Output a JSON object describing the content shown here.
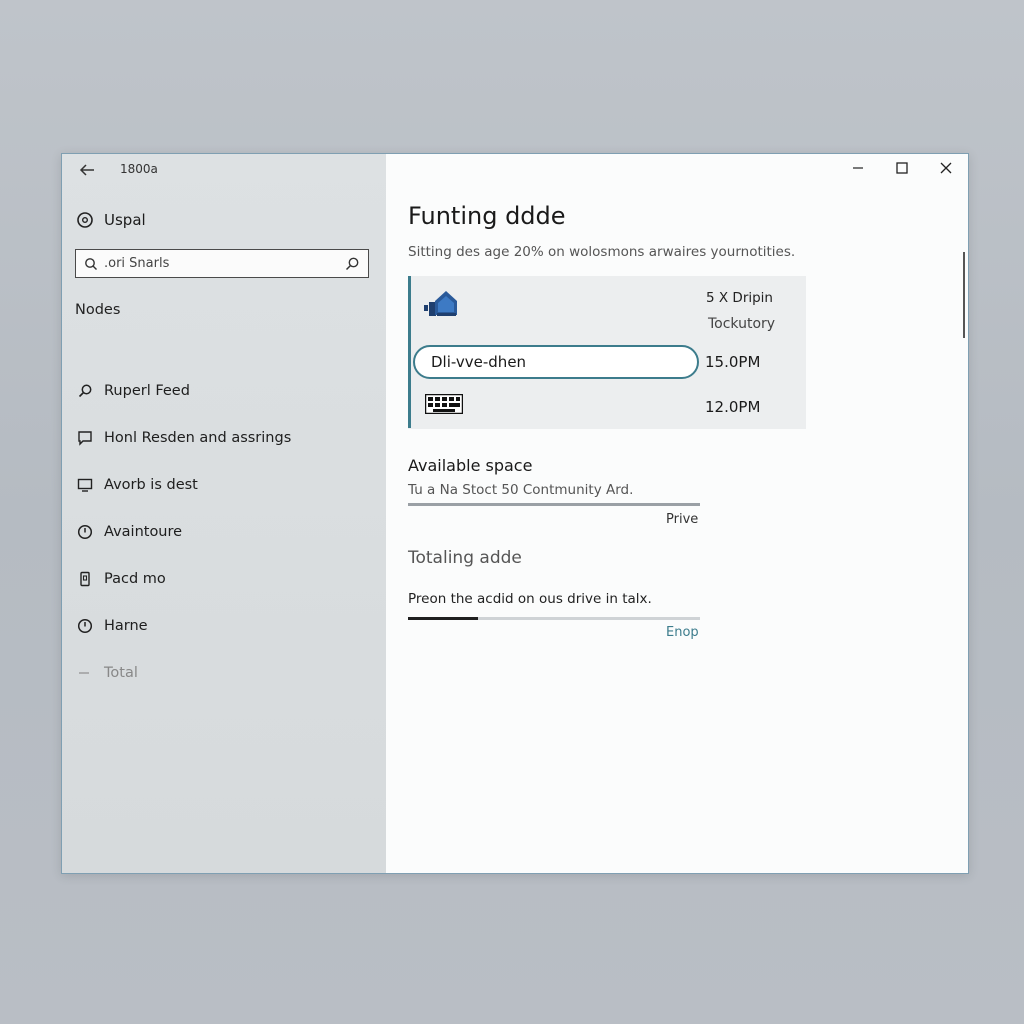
{
  "window": {
    "app_title": "1800a",
    "controls": {
      "minimize": "minimize-icon",
      "maximize": "maximize-icon",
      "close": "close-icon"
    }
  },
  "sidebar": {
    "home_label": "Uspal",
    "search": {
      "value": ".ori Snarls"
    },
    "section_title": "Nodes",
    "items": [
      {
        "label": "Ruperl Feed",
        "icon": "search-icon"
      },
      {
        "label": "Honl Resden and assrings",
        "icon": "chat-icon"
      },
      {
        "label": "Avorb is dest",
        "icon": "display-icon"
      },
      {
        "label": "Avaintoure",
        "icon": "clock-icon"
      },
      {
        "label": "Pacd mo",
        "icon": "phone-icon"
      },
      {
        "label": "Harne",
        "icon": "clock-icon"
      },
      {
        "label": "Total",
        "icon": "dash-icon"
      }
    ]
  },
  "main": {
    "title": "Funting ddde",
    "subtitle": "Sitting des age 20% on wolosmons arwaires yournotities.",
    "drive_panel": {
      "info_line_1": "5 X Dripin",
      "info_line_2": "Tockutory",
      "drive_field_value": "Dli-vve-dhen",
      "time_1": "15.0PM",
      "time_2": "12.0PM"
    },
    "available": {
      "title": "Available space",
      "description": "Tu a Na Stoct 50 Contmunity Ard.",
      "bar_fraction": 1.0,
      "link": "Prive"
    },
    "totaling": {
      "title": "Totaling adde",
      "description": "Preon the acdid on ous drive in talx.",
      "bar_fraction": 0.24,
      "link": "Enop"
    }
  },
  "colors": {
    "accent": "#3c7c8c",
    "sidebar_bg": "#d9dddf",
    "content_bg": "#fbfcfc"
  }
}
